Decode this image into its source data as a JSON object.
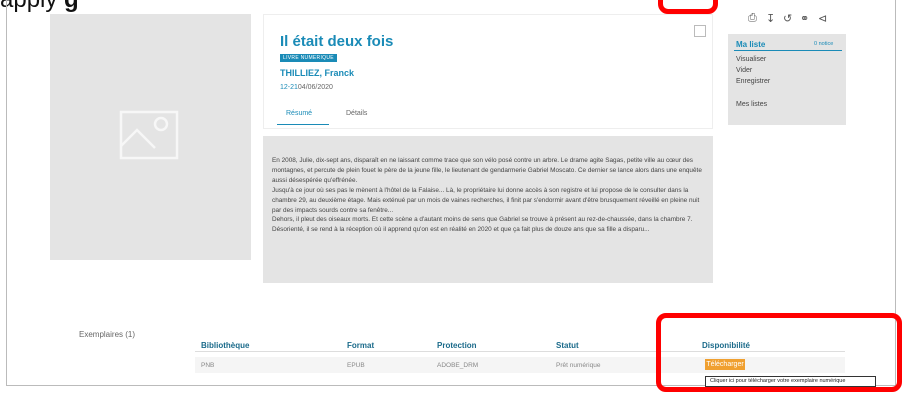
{
  "caption": {
    "prefix": "apply",
    "bold": "g"
  },
  "toolbar": {
    "icons": [
      "print-icon",
      "export-icon",
      "history-icon",
      "link-icon",
      "share-icon"
    ]
  },
  "record": {
    "title": "Il était deux fois",
    "badge": "LIVRE NUMERIQUE",
    "author": "THILLIEZ, Franck",
    "age_range": "12-21",
    "date": "04/06/2020",
    "tabs": [
      "Résumé",
      "Détails"
    ],
    "active_tab": "Résumé"
  },
  "summary": {
    "paragraphs": [
      "En 2008, Julie, dix-sept ans, disparaît en ne laissant comme trace que son vélo posé contre un arbre. Le drame agite Sagas, petite ville au cœur des montagnes, et percute de plein fouet le père de la jeune fille, le lieutenant de gendarmerie Gabriel Moscato. Ce dernier se lance alors dans une enquête aussi désespérée qu'effrénée.",
      "Jusqu'à ce jour où ses pas le mènent à l'hôtel de la Falaise... Là, le propriétaire lui donne accès à son registre et lui propose de le consulter dans la chambre 29, au deuxième étage. Mais exténué par un mois de vaines recherches, il finit par s'endormir avant d'être brusquement réveillé en pleine nuit par des impacts sourds contre sa fenêtre...",
      "Dehors, il pleut des oiseaux morts. Et cette scène a d'autant moins de sens que Gabriel se trouve à présent au rez-de-chaussée, dans la chambre 7. Désorienté, il se rend à la réception où il apprend qu'on est en réalité en 2020 et que ça fait plus de douze ans que sa fille a disparu..."
    ]
  },
  "sidebar": {
    "title": "Ma liste",
    "count": "0 notice",
    "links": [
      "Visualiser",
      "Vider",
      "Enregistrer",
      "Mes listes"
    ]
  },
  "exemplaires": {
    "label": "Exemplaires (1)",
    "columns": [
      "Bibliothèque",
      "Format",
      "Protection",
      "Statut",
      "Disponibilité"
    ],
    "rows": [
      {
        "bibliotheque": "PNB",
        "format": "EPUB",
        "protection": "ADOBE_DRM",
        "statut": "Prêt numérique",
        "action": "Télécharger"
      }
    ],
    "tooltip": "Cliquer ici pour télécharger votre exemplaire numérique"
  },
  "colors": {
    "accent": "#1a8bb7",
    "highlight": "#ff0000",
    "button": "#f0a030"
  }
}
